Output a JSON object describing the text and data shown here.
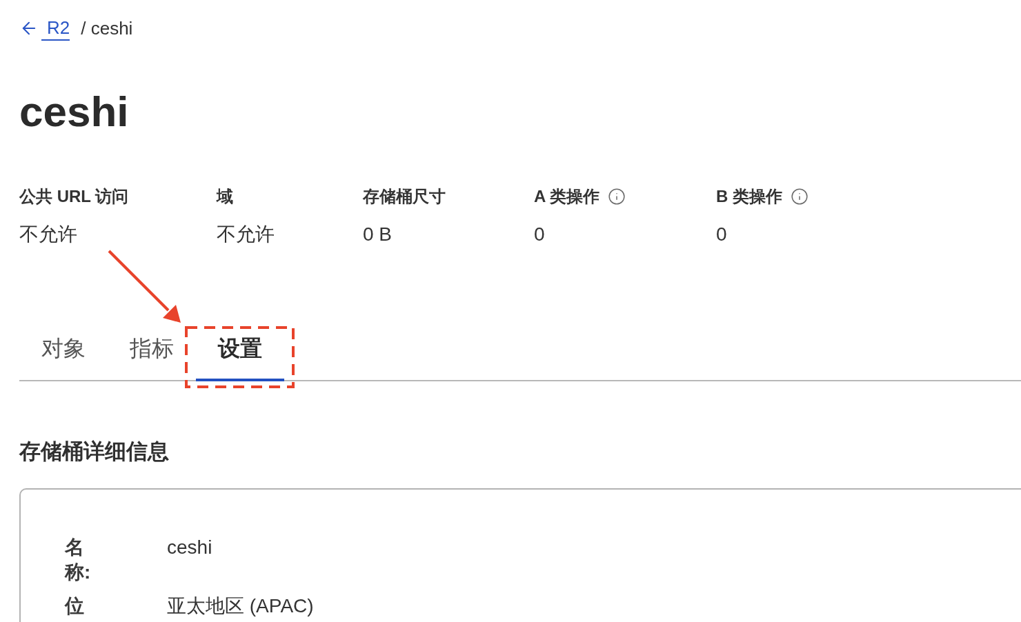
{
  "breadcrumb": {
    "back_link": "R2",
    "current": "/ ceshi"
  },
  "title": "ceshi",
  "stats": [
    {
      "label": "公共 URL 访问",
      "value": "不允许",
      "info": false
    },
    {
      "label": "域",
      "value": "不允许",
      "info": false
    },
    {
      "label": "存储桶尺寸",
      "value": "0 B",
      "info": false
    },
    {
      "label": "A 类操作",
      "value": "0",
      "info": true
    },
    {
      "label": "B 类操作",
      "value": "0",
      "info": true
    }
  ],
  "tabs": [
    {
      "label": "对象",
      "selected": false
    },
    {
      "label": "指标",
      "selected": false
    },
    {
      "label": "设置",
      "selected": true
    }
  ],
  "details": {
    "heading": "存储桶详细信息",
    "rows": [
      {
        "label": "名称:",
        "value": "ceshi"
      },
      {
        "label": "位",
        "value": "亚太地区 (APAC)"
      }
    ]
  }
}
